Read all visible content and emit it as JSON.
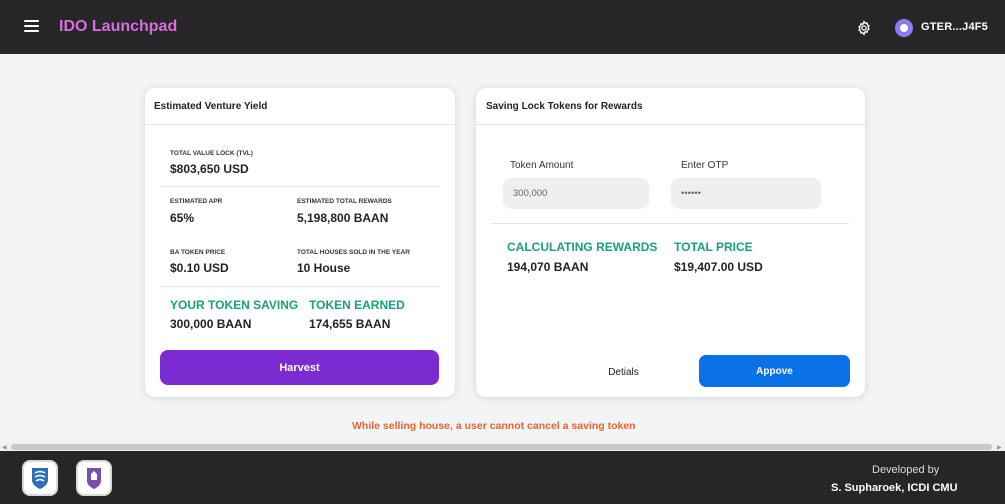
{
  "header": {
    "title": "IDO Launchpad",
    "wallet": "GTER...J4F5"
  },
  "yield_card": {
    "title": "Estimated Venture Yield",
    "tvl_label": "TOTAL VALUE LOCK (TVL)",
    "tvl_value": "$803,650 USD",
    "apr_label": "ESTIMATED APR",
    "apr_value": "65%",
    "rewards_label": "ESTIMATED TOTAL REWARDS",
    "rewards_value": "5,198,800 BAAN",
    "price_label": "BA TOKEN PRICE",
    "price_value": "$0.10 USD",
    "houses_label": "TOTAL HOUSES SOLD IN THE YEAR",
    "houses_value": "10 House",
    "saving_label": "YOUR TOKEN SAVING",
    "saving_value": "300,000 BAAN",
    "earned_label": "TOKEN EARNED",
    "earned_value": "174,655 BAAN",
    "harvest_label": "Harvest"
  },
  "lock_card": {
    "title": "Saving Lock Tokens for Rewards",
    "amount_label": "Token Amount",
    "amount_value": "300,000",
    "otp_label": "Enter OTP",
    "otp_value": "••••••",
    "calc_label": "CALCULATING REWARDS",
    "calc_value": "194,070 BAAN",
    "total_label": "TOTAL PRICE",
    "total_value": "$19,407.00 USD",
    "details_label": "Detials",
    "approve_label": "Appove"
  },
  "warning": "While selling house, a user cannot cancel a saving token",
  "footer": {
    "developed_by": "Developed by",
    "developer": "S. Supharoek, ICDI CMU"
  }
}
